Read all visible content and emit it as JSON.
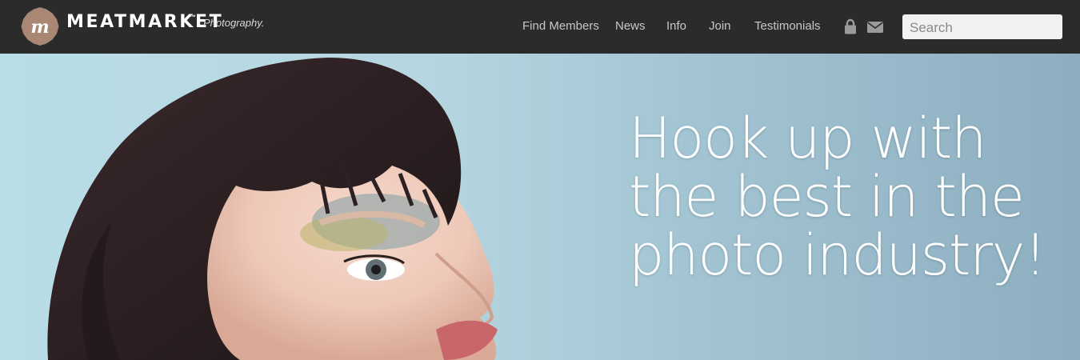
{
  "brand": {
    "name": "MEATMARKET",
    "trademark": "™",
    "tagline": "Photography.",
    "logo_color": "#a98774"
  },
  "nav": {
    "items": [
      {
        "label": "Find Members"
      },
      {
        "label": "News"
      },
      {
        "label": "Info"
      },
      {
        "label": "Join"
      },
      {
        "label": "Testimonials"
      }
    ],
    "icons": [
      "lock-icon",
      "mail-icon"
    ]
  },
  "search": {
    "placeholder": "Search",
    "value": ""
  },
  "hero": {
    "headline_lines": [
      "Hook up with",
      "the best in the",
      "photo industry!"
    ]
  },
  "colors": {
    "topbar_bg": "#2b2b2b",
    "nav_text": "#c8c8c8",
    "hero_bg": "#b5d6e0"
  }
}
